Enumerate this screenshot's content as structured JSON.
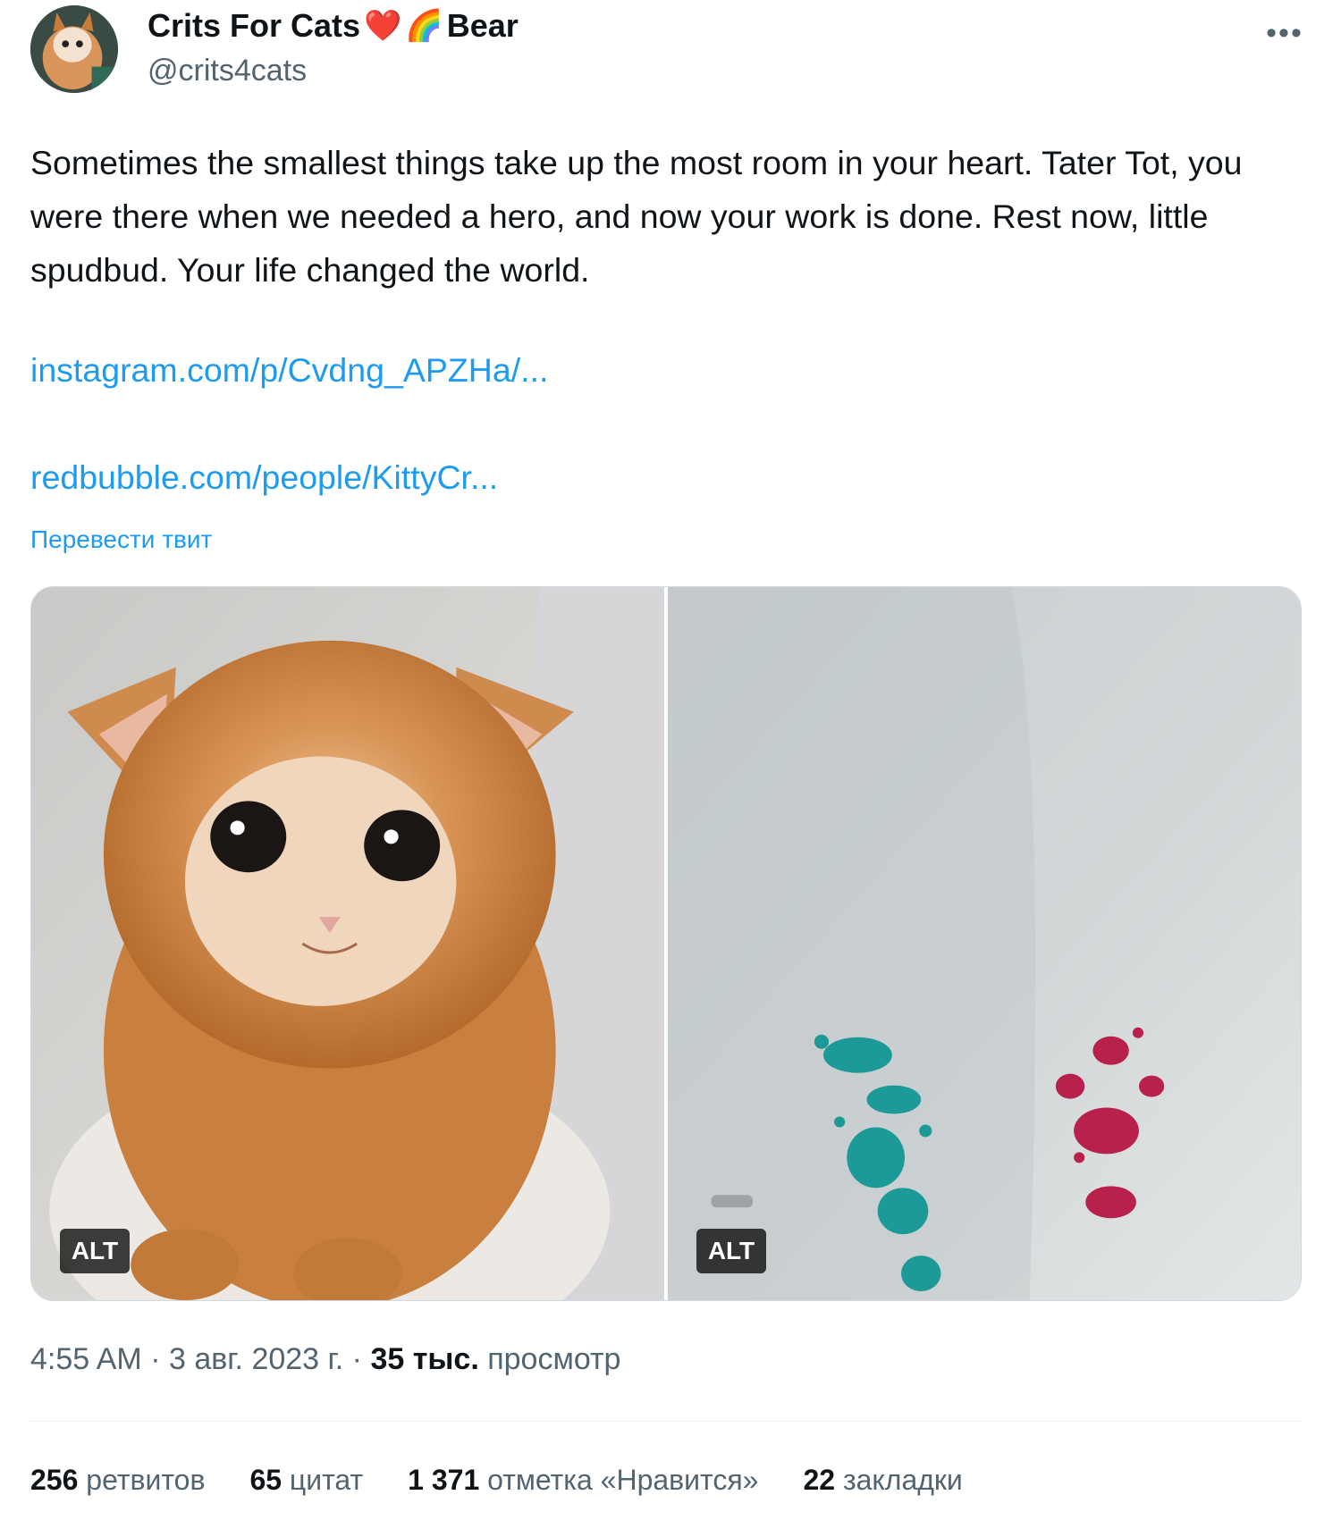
{
  "author": {
    "display_name": "Crits For Cats",
    "name_emoji": [
      "❤️",
      "🌈"
    ],
    "name_suffix": "Bear",
    "handle": "@crits4cats"
  },
  "more_icon": "more-dots-icon",
  "tweet": {
    "text": "Sometimes the smallest things take up the most room in your heart. Tater Tot, you were there when we needed a hero, and now your work is done. Rest now, little spudbud. Your life changed the world.",
    "links": [
      "instagram.com/p/Cvdng_APZHa/...",
      "redbubble.com/people/KittyCr..."
    ],
    "translate_label": "Перевести твит"
  },
  "media": {
    "alt_labels": [
      "ALT",
      "ALT"
    ]
  },
  "meta": {
    "time": "4:55 AM",
    "separator": " · ",
    "date": "3 авг. 2023 г.",
    "views_count": "35 тыс.",
    "views_label": "просмотр"
  },
  "stats": [
    {
      "count": "256",
      "label": "ретвитов"
    },
    {
      "count": "65",
      "label": "цитат"
    },
    {
      "count": "1 371",
      "label": "отметка «Нравится»"
    },
    {
      "count": "22",
      "label": "закладки"
    }
  ],
  "colors": {
    "link": "#1d9bf0",
    "secondary_text": "#536471",
    "primary_text": "#0f1419"
  }
}
